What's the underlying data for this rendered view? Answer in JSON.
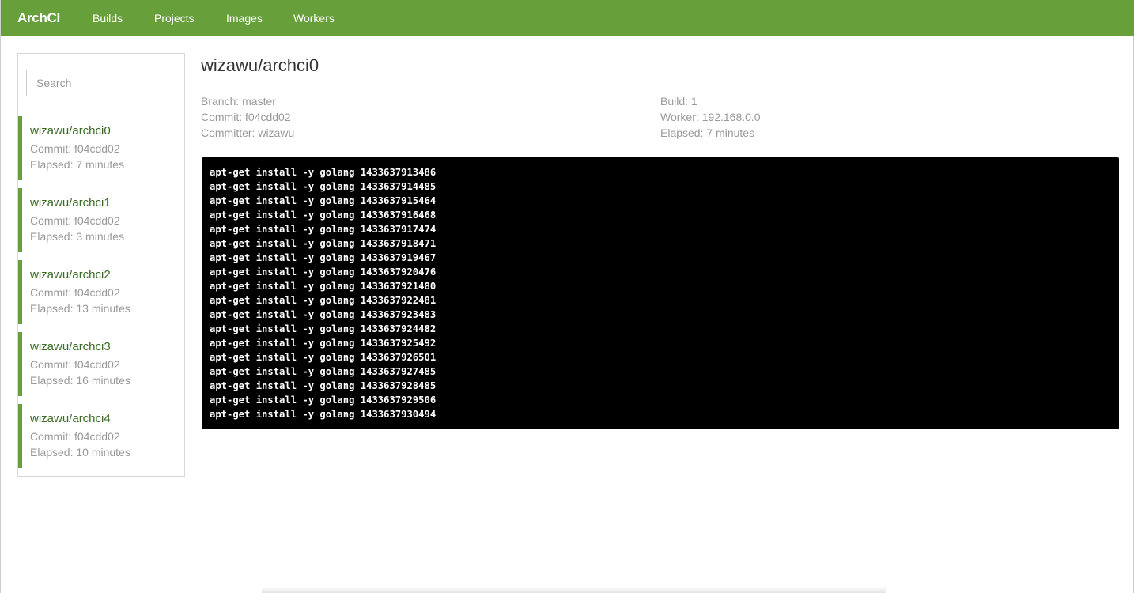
{
  "navbar": {
    "brand": "ArchCI",
    "links": [
      "Builds",
      "Projects",
      "Images",
      "Workers"
    ]
  },
  "sidebar": {
    "search_placeholder": "Search",
    "items": [
      {
        "name": "wizawu/archci0",
        "commit": "Commit: f04cdd02",
        "elapsed": "Elapsed: 7 minutes"
      },
      {
        "name": "wizawu/archci1",
        "commit": "Commit: f04cdd02",
        "elapsed": "Elapsed: 3 minutes"
      },
      {
        "name": "wizawu/archci2",
        "commit": "Commit: f04cdd02",
        "elapsed": "Elapsed: 13 minutes"
      },
      {
        "name": "wizawu/archci3",
        "commit": "Commit: f04cdd02",
        "elapsed": "Elapsed: 16 minutes"
      },
      {
        "name": "wizawu/archci4",
        "commit": "Commit: f04cdd02",
        "elapsed": "Elapsed: 10 minutes"
      }
    ]
  },
  "main": {
    "title": "wizawu/archci0",
    "branch": "Branch: master",
    "commit": "Commit: f04cdd02",
    "committer": "Committer: wizawu",
    "build": "Build: 1",
    "worker": "Worker: 192.168.0.0",
    "elapsed": "Elapsed: 7 minutes"
  },
  "console": {
    "lines": [
      "apt-get install -y golang 1433637913486",
      "apt-get install -y golang 1433637914485",
      "apt-get install -y golang 1433637915464",
      "apt-get install -y golang 1433637916468",
      "apt-get install -y golang 1433637917474",
      "apt-get install -y golang 1433637918471",
      "apt-get install -y golang 1433637919467",
      "apt-get install -y golang 1433637920476",
      "apt-get install -y golang 1433637921480",
      "apt-get install -y golang 1433637922481",
      "apt-get install -y golang 1433637923483",
      "apt-get install -y golang 1433637924482",
      "apt-get install -y golang 1433637925492",
      "apt-get install -y golang 1433637926501",
      "apt-get install -y golang 1433637927485",
      "apt-get install -y golang 1433637928485",
      "apt-get install -y golang 1433637929506",
      "apt-get install -y golang 1433637930494"
    ]
  },
  "colors": {
    "accent": "#67a03b",
    "link": "#3c6a25",
    "muted": "#999999",
    "console_bg": "#000000"
  }
}
